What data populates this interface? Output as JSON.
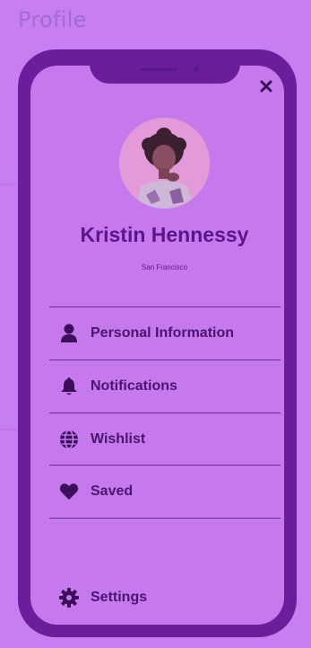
{
  "header": {
    "title": "Profile"
  },
  "profile": {
    "name": "Kristin Hennessy",
    "location": "San Francisco"
  },
  "menu": [
    {
      "label": "Personal Information",
      "icon": "user-icon"
    },
    {
      "label": "Notifications",
      "icon": "bell-icon"
    },
    {
      "label": "Wishlist",
      "icon": "globe-icon"
    },
    {
      "label": "Saved",
      "icon": "heart-icon"
    }
  ],
  "settings": {
    "label": "Settings",
    "icon": "gear-icon"
  },
  "colors": {
    "background": "#c77ef0",
    "phone_frame": "#6a1e9a",
    "screen": "#c579ec",
    "text_dark": "#4a1470"
  }
}
